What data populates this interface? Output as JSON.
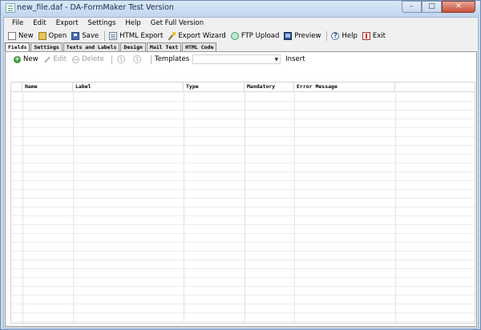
{
  "window": {
    "title": "new_file.daf - DA-FormMaker  Test Version",
    "controls": {
      "minimize": "–",
      "maximize": "□",
      "close": "✕"
    }
  },
  "menu": [
    "File",
    "Edit",
    "Export",
    "Settings",
    "Help",
    "Get Full Version"
  ],
  "toolbar": {
    "new": "New",
    "open": "Open",
    "save": "Save",
    "html_export": "HTML Export",
    "export_wizard": "Export Wizard",
    "ftp_upload": "FTP Upload",
    "preview": "Preview",
    "help": "Help",
    "exit": "Exit"
  },
  "tabs": [
    "Fields",
    "Settings",
    "Texts and Labels",
    "Design",
    "Mail Text",
    "HTML Code"
  ],
  "fields_toolbar": {
    "new": "New",
    "edit": "Edit",
    "delete": "Delete",
    "move_up": "⇧",
    "move_down": "⇩",
    "templates_label": "Templates",
    "templates_value": "",
    "insert": "Insert"
  },
  "grid": {
    "columns": [
      "",
      "Name",
      "Label",
      "Type",
      "Mandatory",
      "Error Message"
    ],
    "rows": []
  }
}
